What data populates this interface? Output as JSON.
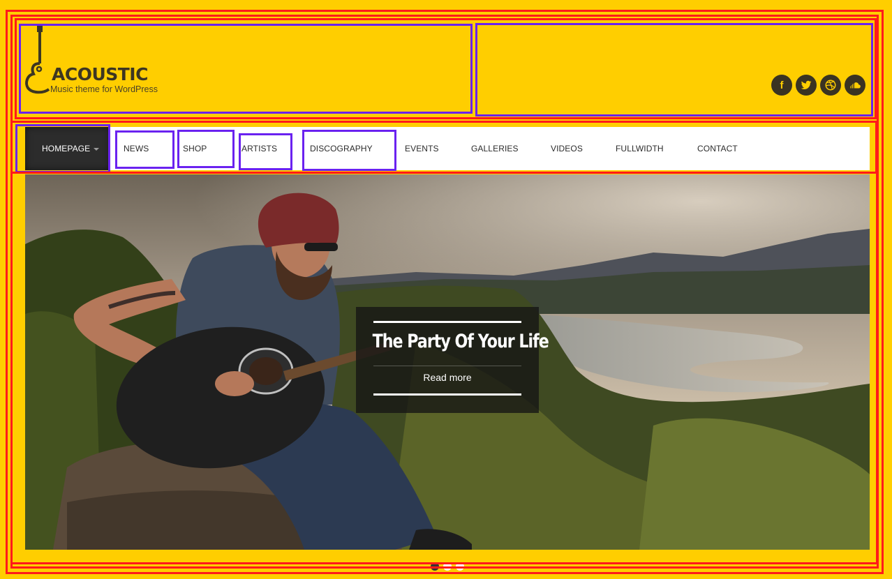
{
  "brand": {
    "title": "ACOUSTIC",
    "tagline": "Music theme for WordPress",
    "icon": "guitar-icon",
    "color": "#3D3622"
  },
  "social": [
    {
      "name": "facebook-icon",
      "glyph": "f"
    },
    {
      "name": "twitter-icon",
      "glyph": ""
    },
    {
      "name": "dribbble-icon",
      "glyph": ""
    },
    {
      "name": "soundcloud-icon",
      "glyph": ""
    }
  ],
  "nav": {
    "items": [
      {
        "label": "HOMEPAGE",
        "active": true,
        "has_dropdown": true
      },
      {
        "label": "NEWS"
      },
      {
        "label": "SHOP"
      },
      {
        "label": "ARTISTS"
      },
      {
        "label": "DISCOGRAPHY"
      },
      {
        "label": "EVENTS"
      },
      {
        "label": "GALLERIES"
      },
      {
        "label": "VIDEOS"
      },
      {
        "label": "FULLWIDTH"
      },
      {
        "label": "CONTACT"
      }
    ]
  },
  "slider": {
    "caption_title": "The Party Of Your Life",
    "caption_link": "Read more",
    "slide_count": 3,
    "current_slide": 1
  },
  "colors": {
    "background": "#FFCE00",
    "nav_active": "#2C2C2C",
    "annotation_red": "#FF1A1A",
    "annotation_purple": "#6A22F0"
  }
}
